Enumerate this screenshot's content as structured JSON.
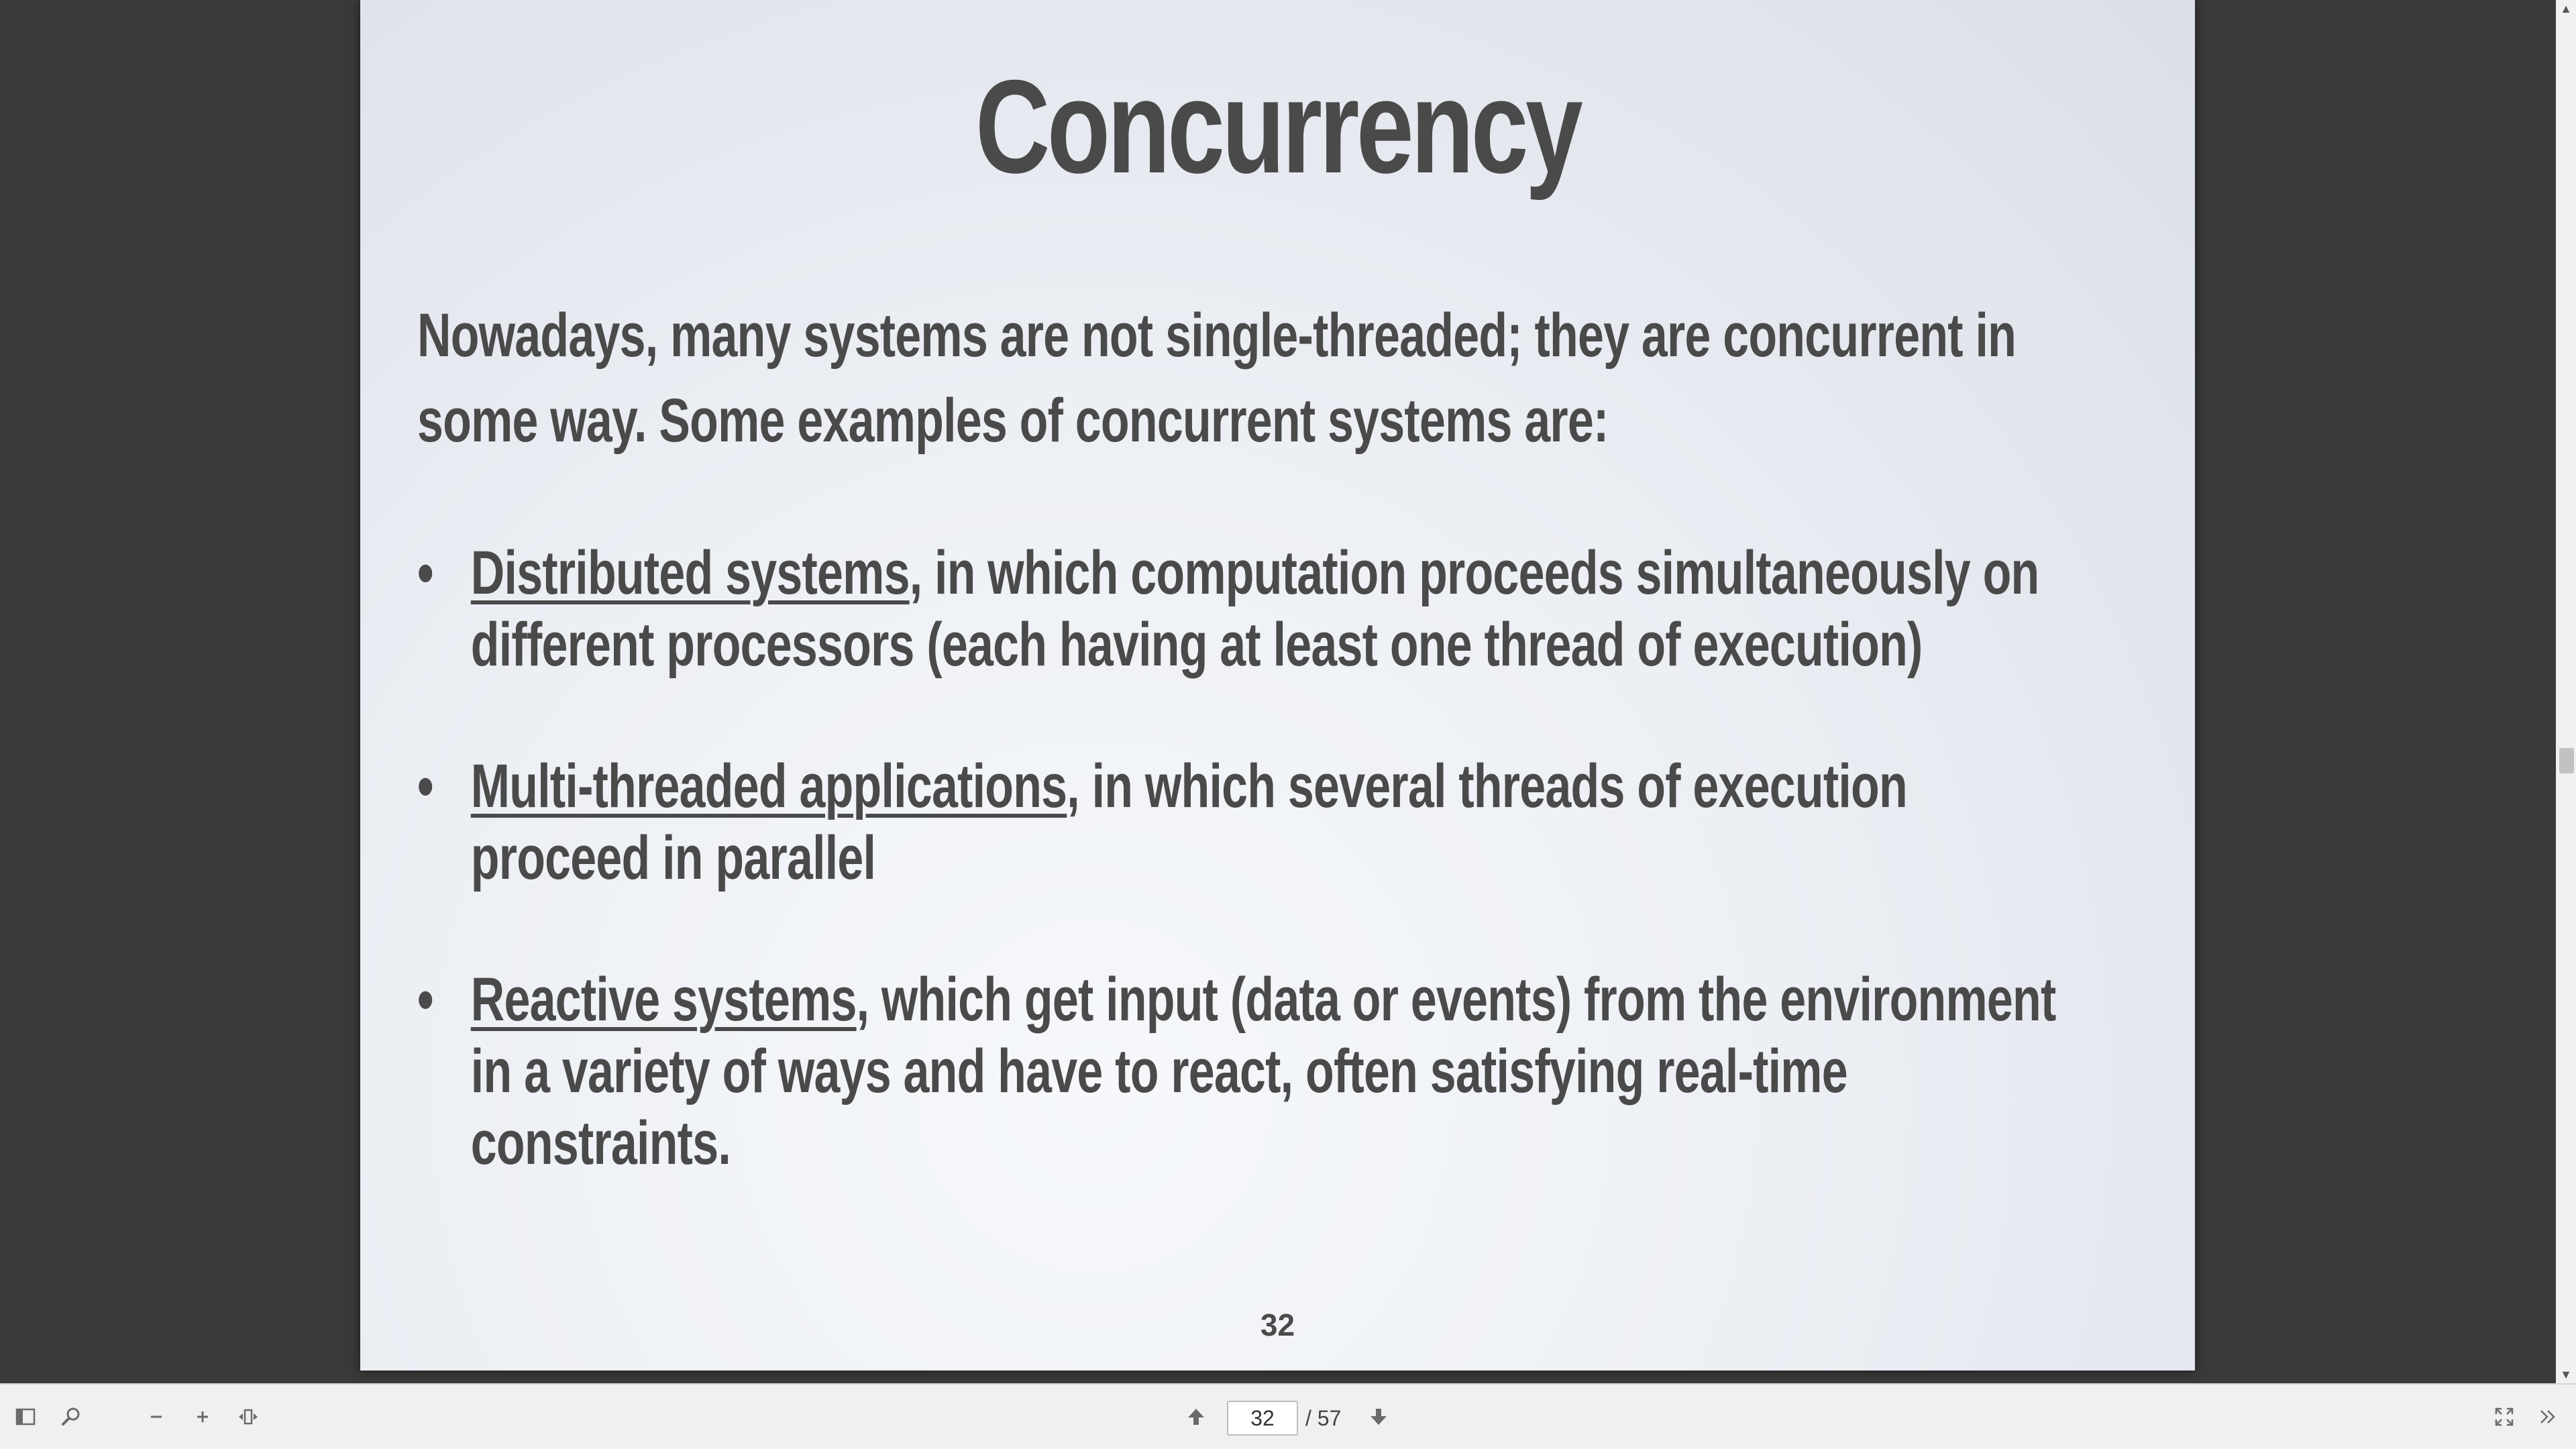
{
  "slide": {
    "title": "Concurrency",
    "intro": "Nowadays, many systems are not single-threaded; they are concurrent in some way. Some examples of concurrent systems are:",
    "bullets": [
      {
        "bullet_char": "•",
        "term": "Distributed systems",
        "text": ", in which computation proceeds simultaneously on different processors (each having at least one thread of execution)"
      },
      {
        "bullet_char": "•",
        "term": "Multi-threaded applications",
        "text": ", in which several threads of execution proceed in parallel"
      },
      {
        "bullet_char": "•",
        "term": "Reactive systems",
        "text": ", which get input (data or events) from the environment in a variety of ways and have to react, often satisfying real-time constraints."
      }
    ],
    "slide_number": "32"
  },
  "toolbar": {
    "page_current": "32",
    "page_total": "/ 57",
    "icons": {
      "sidebar": "sidebar-toggle-icon",
      "search": "search-icon",
      "zoom_out": "zoom-out-icon",
      "zoom_in": "zoom-in-icon",
      "fit": "fit-page-icon",
      "prev": "arrow-up-icon",
      "next": "arrow-down-icon",
      "fullscreen": "fullscreen-icon",
      "more": "double-chevron-right-icon"
    }
  },
  "scrollbar": {
    "up_arrow": "▲",
    "down_arrow": "▼"
  },
  "colors": {
    "viewer_background": "#3a3a3a",
    "slide_text": "#4a4a4a",
    "toolbar_background": "#f0f0f0"
  }
}
